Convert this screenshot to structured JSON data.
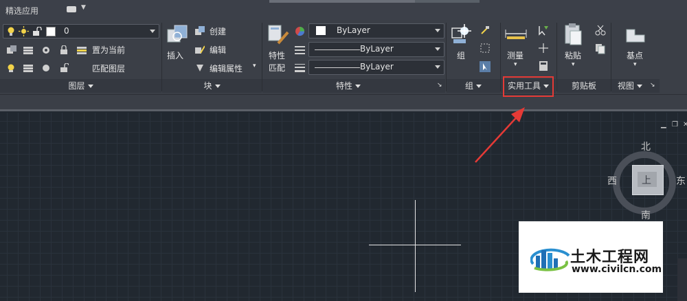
{
  "topbar": {
    "app_tab": "精选应用"
  },
  "layers": {
    "current_layer": "0",
    "set_current": "置为当前",
    "match_layer": "匹配图层",
    "title": "图层"
  },
  "block": {
    "insert": "插入",
    "create": "创建",
    "edit": "编辑",
    "edit_attributes": "编辑属性",
    "title": "块"
  },
  "properties": {
    "match_line1": "特性",
    "match_line2": "匹配",
    "color_value": "ByLayer",
    "linetype_value": "ByLayer",
    "lineweight_value": "ByLayer",
    "title": "特性"
  },
  "groups": {
    "group": "组",
    "title": "组"
  },
  "utilities": {
    "measure": "测量",
    "title": "实用工具"
  },
  "clipboard": {
    "paste": "粘贴",
    "title": "剪贴板"
  },
  "view": {
    "base_point": "基点",
    "title": "视图"
  },
  "viewcube": {
    "north": "北",
    "south": "南",
    "east": "东",
    "west": "西",
    "face": "上"
  },
  "watermark": {
    "site_name": "土木工程网",
    "url": "www.civilcn.com"
  },
  "colors": {
    "highlight": "#e53a36",
    "ribbon_bg": "#3b3f47",
    "canvas_bg": "#212830"
  }
}
